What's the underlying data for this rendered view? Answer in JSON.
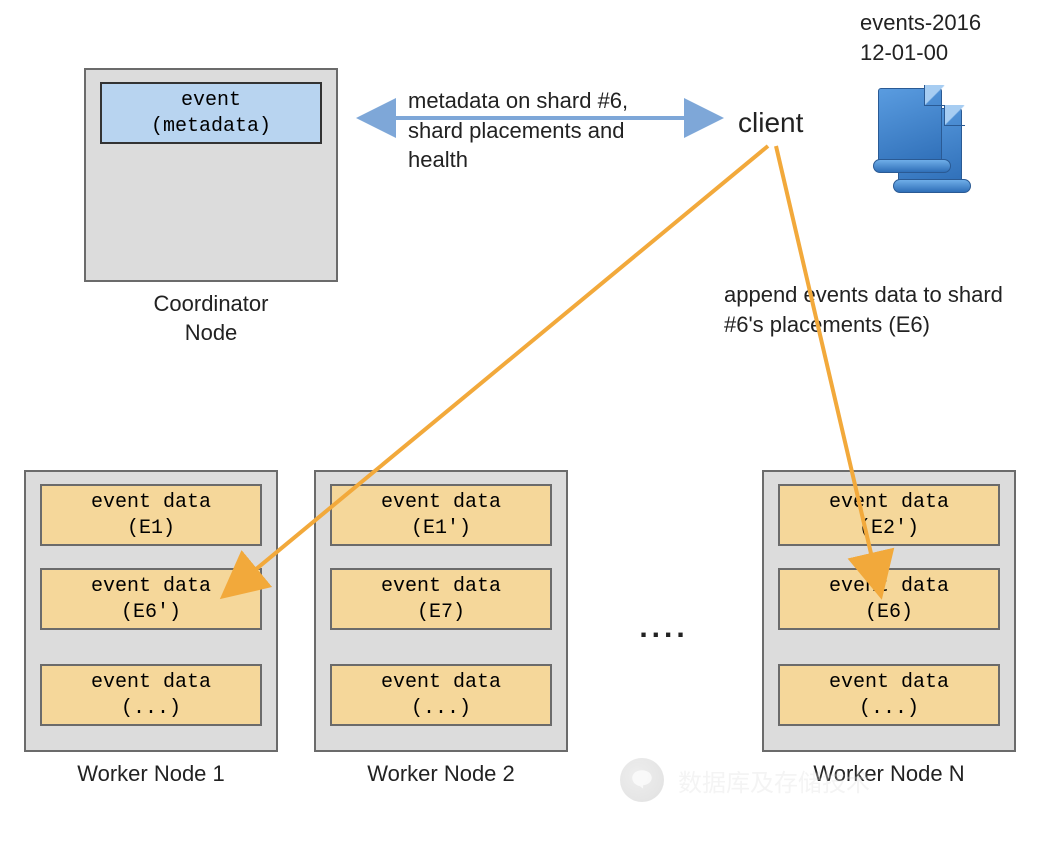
{
  "coordinator": {
    "label": "Coordinator\nNode",
    "meta_line1": "event",
    "meta_line2": "(metadata)"
  },
  "client": {
    "label": "client",
    "file_label_line1": "events-2016",
    "file_label_line2": "12-01-00"
  },
  "annotations": {
    "metadata_text": "metadata on shard #6, shard placements and health",
    "append_text": "append events data to shard #6's placements (E6)"
  },
  "ellipsis": "....",
  "workers": [
    {
      "label": "Worker Node 1",
      "shards": [
        "event data\n(E1)",
        "event data\n(E6')",
        "event data\n(...)"
      ]
    },
    {
      "label": "Worker Node 2",
      "shards": [
        "event data\n(E1')",
        "event data\n(E7)",
        "event data\n(...)"
      ]
    },
    {
      "label": "Worker Node N",
      "shards": [
        "event data\n(E2')",
        "event data\n(E6)",
        "event data\n(...)"
      ]
    }
  ],
  "watermark": "数据库及存储技术"
}
